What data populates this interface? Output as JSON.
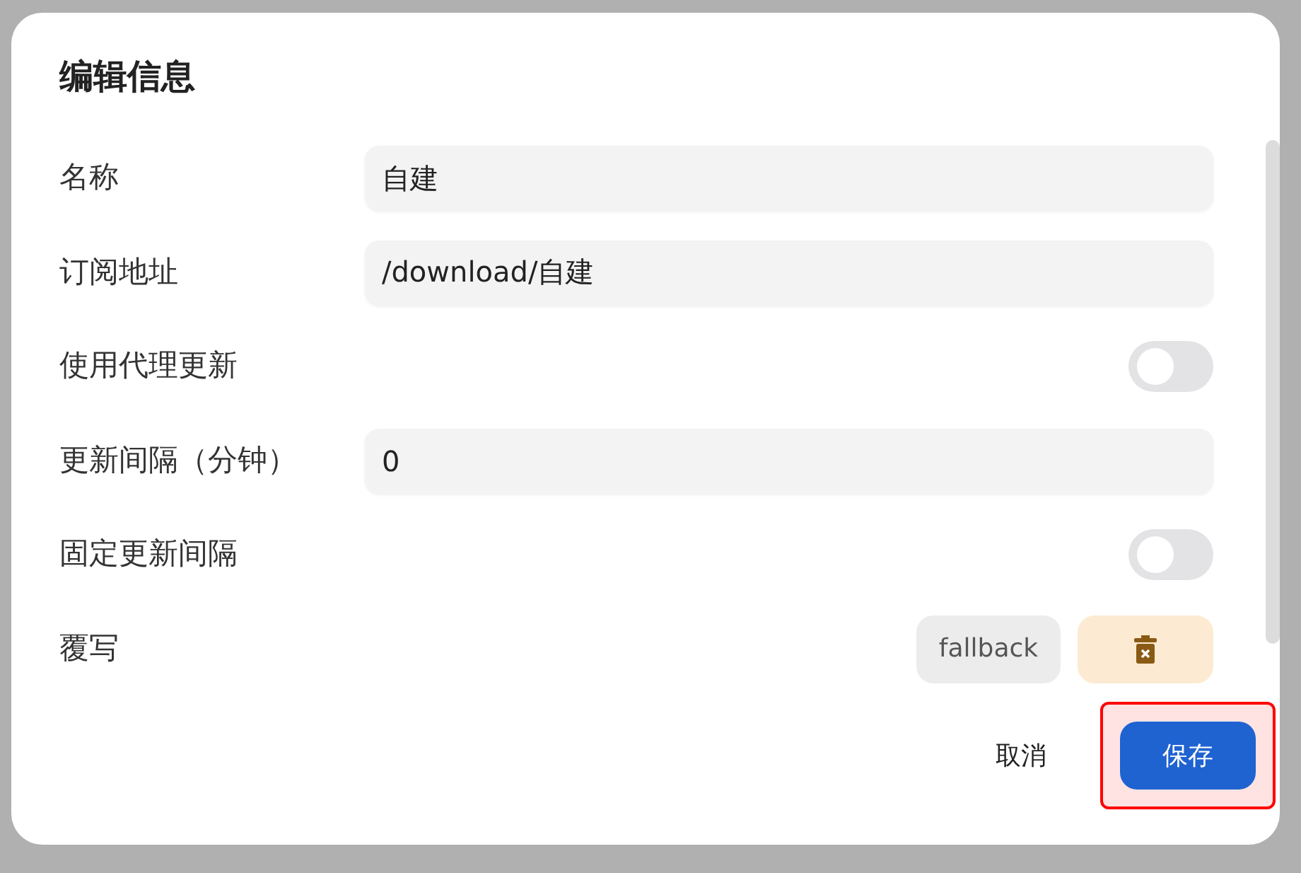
{
  "dialog": {
    "title": "编辑信息"
  },
  "fields": [
    {
      "kind": "input",
      "label": "名称",
      "value": "自建"
    },
    {
      "kind": "input",
      "label": "订阅地址",
      "value": "/download/自建"
    },
    {
      "kind": "toggle",
      "label": "使用代理更新",
      "on": false
    },
    {
      "kind": "input",
      "label": "更新间隔（分钟）",
      "value": "0"
    },
    {
      "kind": "toggle",
      "label": "固定更新间隔",
      "on": false
    },
    {
      "kind": "override",
      "label": "覆写",
      "tag": "fallback"
    }
  ],
  "buttons": [
    {
      "label": "取消",
      "kind": "text",
      "highlighted": false
    },
    {
      "label": "保存",
      "kind": "primary",
      "highlighted": true
    }
  ]
}
